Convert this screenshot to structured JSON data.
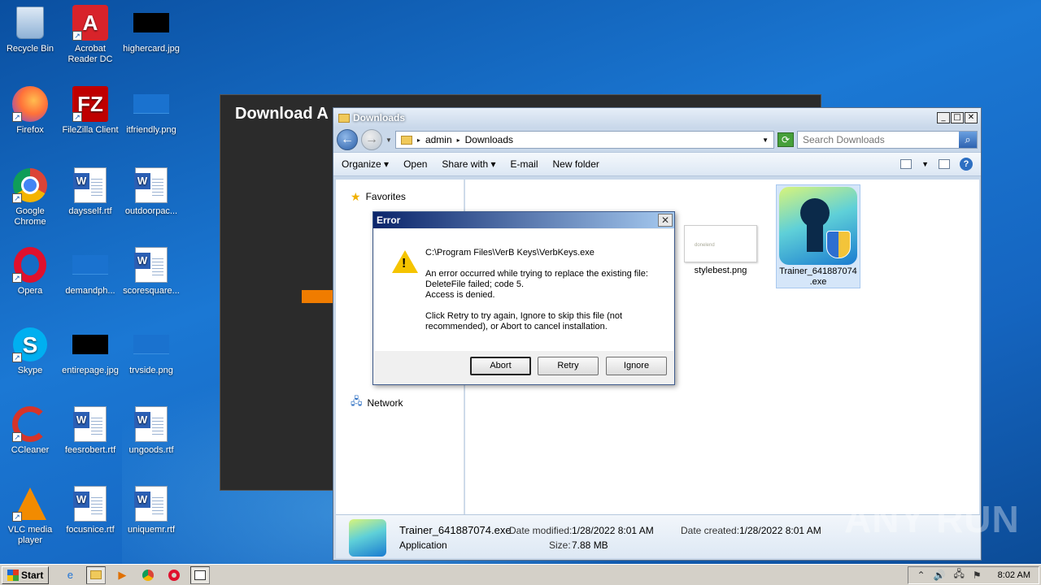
{
  "desktop": {
    "icons": [
      {
        "label": "Recycle Bin",
        "icon": "recycle-bin-icon"
      },
      {
        "label": "Acrobat Reader DC",
        "icon": "acrobat-icon"
      },
      {
        "label": "highercard.jpg",
        "icon": "image-file-icon"
      },
      {
        "label": "Firefox",
        "icon": "firefox-icon"
      },
      {
        "label": "FileZilla Client",
        "icon": "filezilla-icon"
      },
      {
        "label": "itfriendly.png",
        "icon": "image-file-icon"
      },
      {
        "label": "Google Chrome",
        "icon": "chrome-icon"
      },
      {
        "label": "daysself.rtf",
        "icon": "word-doc-icon"
      },
      {
        "label": "outdoorpac...",
        "icon": "word-doc-icon"
      },
      {
        "label": "Opera",
        "icon": "opera-icon"
      },
      {
        "label": "demandph...",
        "icon": "image-file-icon"
      },
      {
        "label": "scoresquare...",
        "icon": "word-doc-icon"
      },
      {
        "label": "Skype",
        "icon": "skype-icon"
      },
      {
        "label": "entirepage.jpg",
        "icon": "image-file-icon"
      },
      {
        "label": "trvside.png",
        "icon": "image-file-icon"
      },
      {
        "label": "CCleaner",
        "icon": "ccleaner-icon"
      },
      {
        "label": "feesrobert.rtf",
        "icon": "word-doc-icon"
      },
      {
        "label": "ungoods.rtf",
        "icon": "word-doc-icon"
      },
      {
        "label": "VLC media player",
        "icon": "vlc-icon"
      },
      {
        "label": "focusnice.rtf",
        "icon": "word-doc-icon"
      },
      {
        "label": "uniquemr.rtf",
        "icon": "word-doc-icon"
      }
    ]
  },
  "background_window": {
    "title": "Download A"
  },
  "explorer": {
    "title": "Downloads",
    "breadcrumb": [
      "admin",
      "Downloads"
    ],
    "search_placeholder": "Search Downloads",
    "toolbar": {
      "organize": "Organize",
      "open": "Open",
      "share_with": "Share with",
      "email": "E-mail",
      "new_folder": "New folder"
    },
    "nav": {
      "favorites": "Favorites",
      "network": "Network"
    },
    "files": [
      {
        "name": "stylebest.png",
        "thumb_text": "donelend"
      },
      {
        "name": "Trainer_641887074.exe",
        "line1": "Trainer_641887074",
        "line2": ".exe"
      }
    ],
    "details": {
      "filename": "Trainer_641887074.exe",
      "type": "Application",
      "modified_label": "Date modified:",
      "modified": "1/28/2022 8:01 AM",
      "created_label": "Date created:",
      "created": "1/28/2022 8:01 AM",
      "size_label": "Size:",
      "size": "7.88 MB"
    }
  },
  "error_dialog": {
    "title": "Error",
    "path": "C:\\Program Files\\VerB Keys\\VerbKeys.exe",
    "message1": "An error occurred while trying to replace the existing file:",
    "message2": "DeleteFile failed; code 5.",
    "message3": "Access is denied.",
    "message4": "Click Retry to try again, Ignore to skip this file (not",
    "message5": "recommended), or Abort to cancel installation.",
    "buttons": {
      "abort": "Abort",
      "retry": "Retry",
      "ignore": "Ignore"
    }
  },
  "watermark": "ANY RUN",
  "taskbar": {
    "start": "Start",
    "clock": "8:02 AM"
  }
}
